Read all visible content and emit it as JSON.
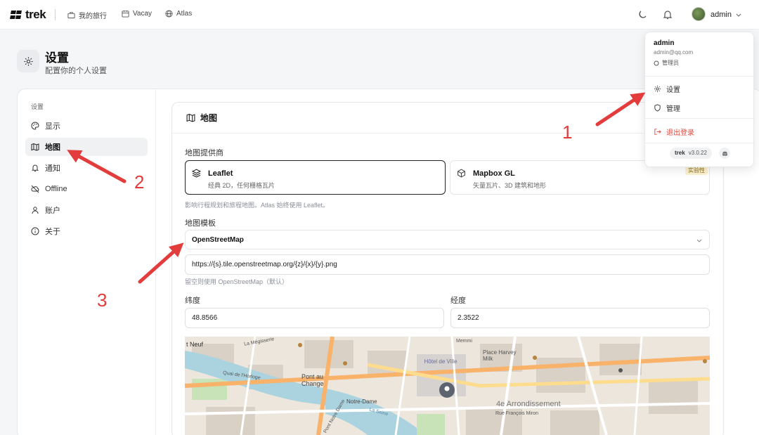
{
  "nav": {
    "logo": "trek",
    "items": [
      {
        "label": "我的旅行",
        "icon": "briefcase-icon"
      },
      {
        "label": "Vacay",
        "icon": "calendar-icon"
      },
      {
        "label": "Atlas",
        "icon": "globe-icon"
      }
    ],
    "user": "admin"
  },
  "page": {
    "title": "设置",
    "subtitle": "配置你的个人设置"
  },
  "sidebar": {
    "heading": "设置",
    "items": [
      {
        "label": "显示",
        "icon": "palette-icon"
      },
      {
        "label": "地图",
        "icon": "map-icon",
        "active": true
      },
      {
        "label": "通知",
        "icon": "bell-icon"
      },
      {
        "label": "Offline",
        "icon": "offline-icon"
      },
      {
        "label": "账户",
        "icon": "user-icon"
      },
      {
        "label": "关于",
        "icon": "info-icon"
      }
    ]
  },
  "map_card": {
    "title": "地图",
    "provider_label": "地图提供商",
    "providers": [
      {
        "name": "Leaflet",
        "desc": "经典 2D，任何栅格瓦片",
        "selected": true
      },
      {
        "name": "Mapbox GL",
        "desc": "矢量瓦片、3D 建筑和地形",
        "badge": "实验性"
      }
    ],
    "provider_hint": "影响行程规划和旅程地图。Atlas 始终使用 Leaflet。",
    "template_label": "地图模板",
    "template_value": "OpenStreetMap",
    "tile_url": "https://{s}.tile.openstreetmap.org/{z}/{x}/{y}.png",
    "tile_hint": "留空则使用 OpenStreetMap（默认）",
    "lat_label": "纬度",
    "lat_value": "48.8566",
    "lng_label": "经度",
    "lng_value": "2.3522",
    "map_labels": [
      "t Neuf",
      "La Mégisserie",
      "Hôtel de Ville",
      "Place Harvey Milk",
      "Pont au Change",
      "Notre-Dame",
      "4e Arrondissement",
      "Rue François Miron",
      "Quai de l'Horloge",
      "La Seine",
      "Pont Notre Dame",
      "Memmi"
    ]
  },
  "dropdown": {
    "name": "admin",
    "email": "admin@qq.com",
    "role": "管理员",
    "settings": "设置",
    "admin": "管理",
    "logout": "退出登录",
    "version_app": "trek",
    "version": "v3.0.22"
  },
  "annotations": [
    "1",
    "2",
    "3"
  ],
  "colors": {
    "accent_red": "#e33c3c",
    "logout_red": "#e0483b"
  }
}
